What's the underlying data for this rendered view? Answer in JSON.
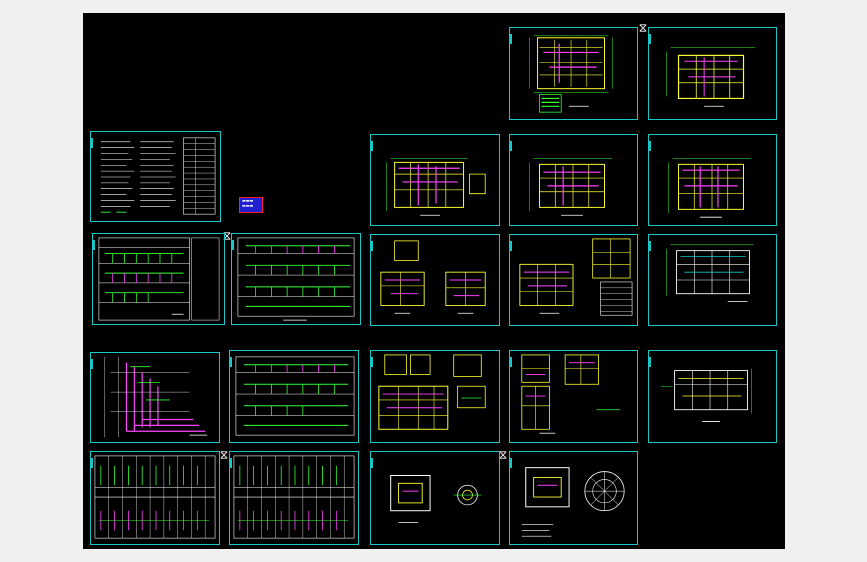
{
  "viewer": {
    "background": "#000000",
    "frame_color": "#19c7c7",
    "colors": {
      "wall": "#ffff33",
      "pipe": "#ff44ff",
      "green": "#33ff33",
      "cyan": "#19c7c7",
      "white": "#ffffff",
      "red": "#ff2020",
      "blue": "#2020d0"
    }
  },
  "sheets": [
    {
      "name": "sheet-floor-plan-top-1",
      "kind": "plan-dense"
    },
    {
      "name": "sheet-floor-plan-top-2",
      "kind": "plan-yellow"
    },
    {
      "name": "sheet-design-notes",
      "kind": "notes"
    },
    {
      "name": "sheet-floor-plan-r2c3",
      "kind": "plan-dense"
    },
    {
      "name": "sheet-floor-plan-r2c4",
      "kind": "plan-dense"
    },
    {
      "name": "sheet-floor-plan-r2c5",
      "kind": "plan-dense"
    },
    {
      "name": "sheet-system-diagram-1",
      "kind": "system"
    },
    {
      "name": "sheet-system-diagram-2",
      "kind": "system"
    },
    {
      "name": "sheet-detail-plans-1",
      "kind": "detail"
    },
    {
      "name": "sheet-detail-plans-2",
      "kind": "detail-table"
    },
    {
      "name": "sheet-floor-plan-r3c5",
      "kind": "plan-white"
    },
    {
      "name": "sheet-riser-diagram",
      "kind": "riser"
    },
    {
      "name": "sheet-system-diagram-3",
      "kind": "system"
    },
    {
      "name": "sheet-room-layouts-1",
      "kind": "rooms"
    },
    {
      "name": "sheet-room-layouts-2",
      "kind": "rooms"
    },
    {
      "name": "sheet-floor-plan-r4c5",
      "kind": "plan-white"
    },
    {
      "name": "sheet-panel-schedule-1",
      "kind": "schedule"
    },
    {
      "name": "sheet-panel-schedule-2",
      "kind": "schedule"
    },
    {
      "name": "sheet-pit-detail",
      "kind": "pit"
    },
    {
      "name": "sheet-tank-detail",
      "kind": "tank"
    }
  ]
}
